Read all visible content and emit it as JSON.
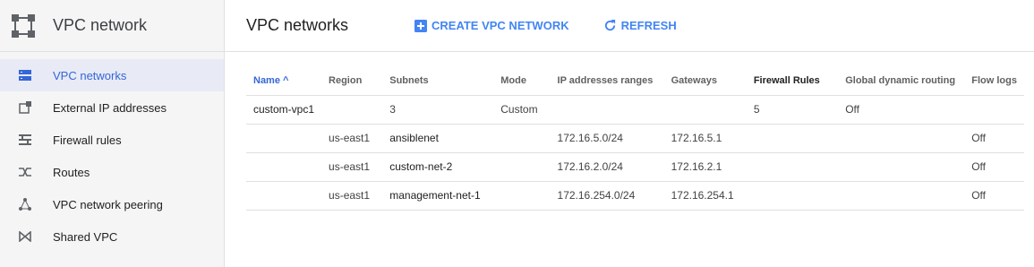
{
  "sidebar": {
    "title": "VPC network",
    "items": [
      {
        "label": "VPC networks",
        "icon": "vpc-networks-icon",
        "active": true
      },
      {
        "label": "External IP addresses",
        "icon": "external-ip-icon",
        "active": false
      },
      {
        "label": "Firewall rules",
        "icon": "firewall-icon",
        "active": false
      },
      {
        "label": "Routes",
        "icon": "routes-icon",
        "active": false
      },
      {
        "label": "VPC network peering",
        "icon": "peering-icon",
        "active": false
      },
      {
        "label": "Shared VPC",
        "icon": "shared-vpc-icon",
        "active": false
      }
    ]
  },
  "header": {
    "title": "VPC networks",
    "create_label": "CREATE VPC NETWORK",
    "refresh_label": "REFRESH"
  },
  "table": {
    "columns": [
      "Name",
      "Region",
      "Subnets",
      "Mode",
      "IP addresses ranges",
      "Gateways",
      "Firewall Rules",
      "Global dynamic routing",
      "Flow logs"
    ],
    "sort_arrow": "^",
    "rows": [
      [
        "custom-vpc1",
        "",
        "3",
        "Custom",
        "",
        "",
        "5",
        "Off",
        ""
      ],
      [
        "",
        "us-east1",
        "ansiblenet",
        "",
        "172.16.5.0/24",
        "172.16.5.1",
        "",
        "",
        "Off"
      ],
      [
        "",
        "us-east1",
        "custom-net-2",
        "",
        "172.16.2.0/24",
        "172.16.2.1",
        "",
        "",
        "Off"
      ],
      [
        "",
        "us-east1",
        "management-net-1",
        "",
        "172.16.254.0/24",
        "172.16.254.1",
        "",
        "",
        "Off"
      ]
    ]
  },
  "colors": {
    "accent": "#4285f4",
    "active_text": "#3367d6",
    "active_bg": "#e8eaf6"
  }
}
